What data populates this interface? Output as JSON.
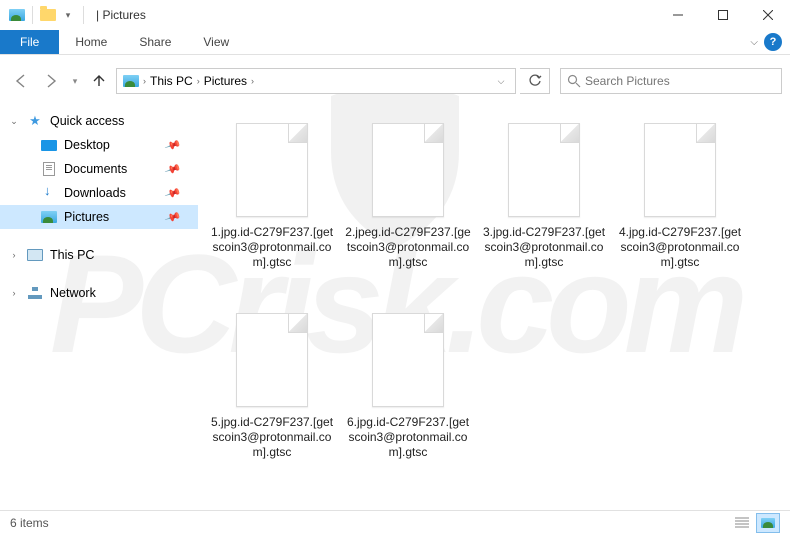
{
  "window": {
    "title": "Pictures",
    "title_separator": "|"
  },
  "ribbon": {
    "file_tab": "File",
    "tabs": [
      "Home",
      "Share",
      "View"
    ]
  },
  "breadcrumb": {
    "segments": [
      "This PC",
      "Pictures"
    ]
  },
  "search": {
    "placeholder": "Search Pictures"
  },
  "navpane": {
    "quick_access": "Quick access",
    "items": [
      {
        "label": "Desktop",
        "icon": "desktop",
        "pinned": true
      },
      {
        "label": "Documents",
        "icon": "doc",
        "pinned": true
      },
      {
        "label": "Downloads",
        "icon": "download",
        "pinned": true
      },
      {
        "label": "Pictures",
        "icon": "photo",
        "pinned": true,
        "selected": true
      }
    ],
    "this_pc": "This PC",
    "network": "Network"
  },
  "files": [
    {
      "name": "1.jpg.id-C279F237.[getscoin3@protonmail.com].gtsc"
    },
    {
      "name": "2.jpeg.id-C279F237.[getscoin3@protonmail.com].gtsc"
    },
    {
      "name": "3.jpg.id-C279F237.[getscoin3@protonmail.com].gtsc"
    },
    {
      "name": "4.jpg.id-C279F237.[getscoin3@protonmail.com].gtsc"
    },
    {
      "name": "5.jpg.id-C279F237.[getscoin3@protonmail.com].gtsc"
    },
    {
      "name": "6.jpg.id-C279F237.[getscoin3@protonmail.com].gtsc"
    }
  ],
  "statusbar": {
    "item_count": "6 items"
  }
}
